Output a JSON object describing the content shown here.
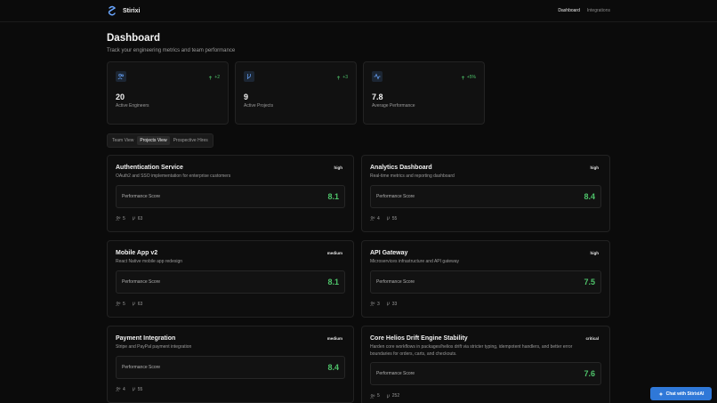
{
  "header": {
    "brand": "Stirixi",
    "nav": [
      {
        "label": "Dashboard",
        "active": true
      },
      {
        "label": "Integrations",
        "active": false
      }
    ]
  },
  "page": {
    "title": "Dashboard",
    "subtitle": "Track your engineering metrics and team performance"
  },
  "stats": [
    {
      "icon": "users-icon",
      "value": "20",
      "label": "Active Engineers",
      "delta": "+2"
    },
    {
      "icon": "git-branch-icon",
      "value": "9",
      "label": "Active Projects",
      "delta": "+3"
    },
    {
      "icon": "activity-icon",
      "value": "7.8",
      "label": "Average Performance",
      "delta": "+5%"
    }
  ],
  "tabs": [
    {
      "label": "Team View",
      "active": false
    },
    {
      "label": "Projects View",
      "active": true
    },
    {
      "label": "Prospective Hires",
      "active": false
    }
  ],
  "projects": [
    {
      "title": "Authentication Service",
      "description": "OAuth2 and SSO implementation for enterprise customers",
      "priority": "high",
      "score_label": "Performance Score",
      "score": "8.1",
      "members": "5",
      "commits": "63"
    },
    {
      "title": "Analytics Dashboard",
      "description": "Real-time metrics and reporting dashboard",
      "priority": "high",
      "score_label": "Performance Score",
      "score": "8.4",
      "members": "4",
      "commits": "55"
    },
    {
      "title": "Mobile App v2",
      "description": "React Native mobile app redesign",
      "priority": "medium",
      "score_label": "Performance Score",
      "score": "8.1",
      "members": "5",
      "commits": "63"
    },
    {
      "title": "API Gateway",
      "description": "Microservices infrastructure and API gateway",
      "priority": "high",
      "score_label": "Performance Score",
      "score": "7.5",
      "members": "3",
      "commits": "33"
    },
    {
      "title": "Payment Integration",
      "description": "Stripe and PayPal payment integration",
      "priority": "medium",
      "score_label": "Performance Score",
      "score": "8.4",
      "members": "4",
      "commits": "55"
    },
    {
      "title": "Core Helios Drift Engine Stability",
      "description": "Harden core workflows in packages/helios drift via stricter typing, idempotent handlers, and better error boundaries for orders, carts, and checkouts.",
      "priority": "critical",
      "score_label": "Performance Score",
      "score": "7.6",
      "members": "5",
      "commits": "252"
    }
  ],
  "chat": {
    "label": "Chat with StirixiAI"
  },
  "colors": {
    "accent_green": "#4ec36a",
    "accent_blue": "#2f78d8",
    "background": "#0b0b0b"
  }
}
